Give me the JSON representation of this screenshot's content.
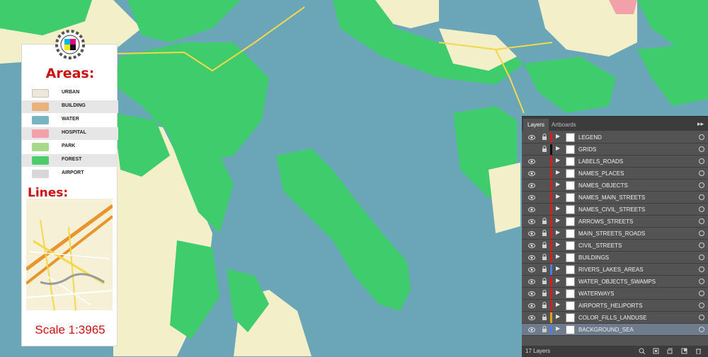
{
  "legend": {
    "areas_title": "Areas:",
    "areas": [
      {
        "label": "URBAN",
        "color": "#eee6d8"
      },
      {
        "label": "BUILDING",
        "color": "#e8b27a"
      },
      {
        "label": "WATER",
        "color": "#7ab3c4"
      },
      {
        "label": "HOSPITAL",
        "color": "#f2a1aa"
      },
      {
        "label": "PARK",
        "color": "#a6d98c"
      },
      {
        "label": "FOREST",
        "color": "#4ccc6a"
      },
      {
        "label": "AIRPORT",
        "color": "#d7d7d7"
      }
    ],
    "lines_title": "Lines:",
    "scale": "Scale  1:3965"
  },
  "layers_panel": {
    "tabs": [
      "Layers",
      "Artboards"
    ],
    "layers": [
      {
        "name": "LEGEND",
        "visible": true,
        "locked": true,
        "color": "#d02020"
      },
      {
        "name": "GRIDS",
        "visible": false,
        "locked": true,
        "color": "#111111"
      },
      {
        "name": "LABELS_ROADS",
        "visible": true,
        "locked": false,
        "color": "#d02020"
      },
      {
        "name": "NAMES_PLACES",
        "visible": true,
        "locked": false,
        "color": "#d02020"
      },
      {
        "name": "NAMES_OBJECTS",
        "visible": true,
        "locked": false,
        "color": "#d02020"
      },
      {
        "name": "NAMES_MAIN_STREETS",
        "visible": true,
        "locked": false,
        "color": "#d02020"
      },
      {
        "name": "NAMES_CIVIL_STREETS",
        "visible": true,
        "locked": false,
        "color": "#d02020"
      },
      {
        "name": "ARROWS_STREETS",
        "visible": true,
        "locked": true,
        "color": "#d02020"
      },
      {
        "name": "MAIN_STREETS_ROADS",
        "visible": true,
        "locked": true,
        "color": "#d02020"
      },
      {
        "name": "CIVIL_STREETS",
        "visible": true,
        "locked": true,
        "color": "#d02020"
      },
      {
        "name": "BUILDINGS",
        "visible": true,
        "locked": true,
        "color": "#d02020"
      },
      {
        "name": "RIVERS_LAKES_AREAS",
        "visible": true,
        "locked": true,
        "color": "#4d7de0"
      },
      {
        "name": "WATER_OBJECTS_SWAMPS",
        "visible": true,
        "locked": true,
        "color": "#d02020"
      },
      {
        "name": "WATERWAYS",
        "visible": true,
        "locked": true,
        "color": "#d02020"
      },
      {
        "name": "AIRPORTS_HELIPORTS",
        "visible": true,
        "locked": true,
        "color": "#d02020"
      },
      {
        "name": "COLOR_FILLS_LANDUSE",
        "visible": true,
        "locked": true,
        "color": "#e0a020"
      },
      {
        "name": "BACKGROUND_SEA",
        "visible": true,
        "locked": true,
        "color": "#4d7de0",
        "selected": true
      }
    ],
    "layer_count": "17 Layers"
  }
}
